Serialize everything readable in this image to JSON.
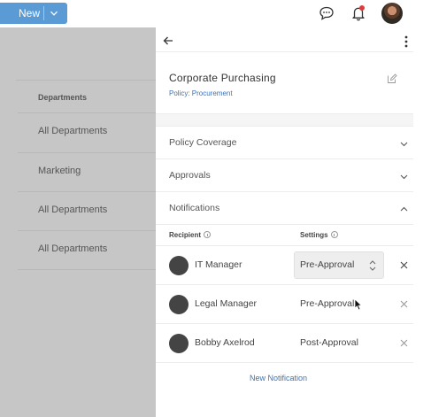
{
  "topbar": {
    "new_button": "New",
    "icons": [
      "chat-icon",
      "bell-icon",
      "user-avatar"
    ],
    "notification_dot_color": "#e03a3a"
  },
  "sidebar": {
    "header": "Departments",
    "items": [
      {
        "label": "All Departments"
      },
      {
        "label": "Marketing"
      },
      {
        "label": "All Departments"
      },
      {
        "label": "All Departments"
      }
    ]
  },
  "panel": {
    "title": "Corporate Purchasing",
    "policy": "Policy: Procurement",
    "sections": [
      {
        "label": "Policy Coverage",
        "expanded": false
      },
      {
        "label": "Approvals",
        "expanded": false
      },
      {
        "label": "Notifications",
        "expanded": true
      }
    ],
    "columns": {
      "recipient": "Recipient",
      "settings": "Settings"
    },
    "recipients": [
      {
        "name": "IT Manager",
        "setting": "Pre-Approval"
      },
      {
        "name": "Legal Manager",
        "setting": "Pre-Approval"
      },
      {
        "name": "Bobby Axelrod",
        "setting": "Post-Approval"
      }
    ],
    "new_notification": "New Notification"
  },
  "colors": {
    "accent": "#5b9bd5",
    "link": "#3b73b9",
    "overlay": "#c6c6c6"
  }
}
